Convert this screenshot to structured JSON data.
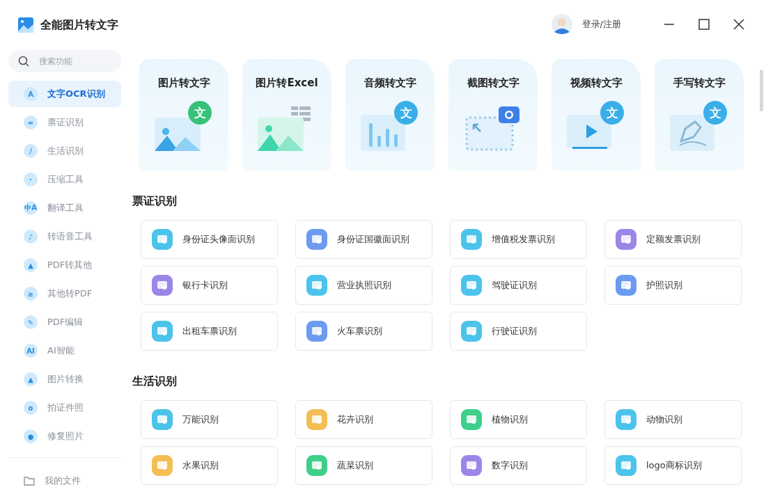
{
  "app": {
    "title": "全能图片转文字"
  },
  "header": {
    "login": "登录/注册"
  },
  "sidebar": {
    "search_placeholder": "搜索功能",
    "items": [
      {
        "label": "文字OCR识别",
        "glyph": "A",
        "selected": true
      },
      {
        "label": "票证识别",
        "glyph": "=",
        "selected": false
      },
      {
        "label": "生活识别",
        "glyph": "/",
        "selected": false
      },
      {
        "label": "压缩工具",
        "glyph": "·",
        "selected": false
      },
      {
        "label": "翻译工具",
        "glyph": "中A",
        "selected": false
      },
      {
        "label": "转语音工具",
        "glyph": "♪",
        "selected": false
      },
      {
        "label": "PDF转其他",
        "glyph": "▲",
        "selected": false
      },
      {
        "label": "其他转PDF",
        "glyph": "≥",
        "selected": false
      },
      {
        "label": "PDF编辑",
        "glyph": "✎",
        "selected": false
      },
      {
        "label": "AI智能",
        "glyph": "AI",
        "selected": false
      },
      {
        "label": "图片转换",
        "glyph": "▲",
        "selected": false
      },
      {
        "label": "拍证件照",
        "glyph": "o",
        "selected": false
      },
      {
        "label": "修复照片",
        "glyph": "●",
        "selected": false
      }
    ],
    "footer": {
      "label": "我的文件"
    }
  },
  "feature_cards": [
    {
      "title": "图片转文字",
      "kind": "image",
      "badge": "文"
    },
    {
      "title": "图片转Excel",
      "kind": "excel"
    },
    {
      "title": "音频转文字",
      "kind": "audio",
      "badge": "文"
    },
    {
      "title": "截图转文字",
      "kind": "screenshot"
    },
    {
      "title": "视频转文字",
      "kind": "video",
      "badge": "文"
    },
    {
      "title": "手写转文字",
      "kind": "handwriting",
      "badge": "文"
    }
  ],
  "sections": [
    {
      "title": "票证识别",
      "tools": [
        {
          "label": "身份证头像面识别",
          "color": "#4cc3ea"
        },
        {
          "label": "身份证国徽面识别",
          "color": "#6b9bf0"
        },
        {
          "label": "增值税发票识别",
          "color": "#4cc3ea"
        },
        {
          "label": "定额发票识别",
          "color": "#9b86e8"
        },
        {
          "label": "银行卡识别",
          "color": "#9b86e8"
        },
        {
          "label": "营业执照识别",
          "color": "#4cc3ea"
        },
        {
          "label": "驾驶证识别",
          "color": "#4cc3ea"
        },
        {
          "label": "护照识别",
          "color": "#6b9bf0"
        },
        {
          "label": "出租车票识别",
          "color": "#4cc3ea"
        },
        {
          "label": "火车票识别",
          "color": "#6b9bf0"
        },
        {
          "label": "行驶证识别",
          "color": "#4cc3ea"
        }
      ]
    },
    {
      "title": "生活识别",
      "tools": [
        {
          "label": "万能识别",
          "color": "#4cc3ea"
        },
        {
          "label": "花卉识别",
          "color": "#f3be55"
        },
        {
          "label": "植物识别",
          "color": "#3fcf8a"
        },
        {
          "label": "动物识别",
          "color": "#4cc3ea"
        },
        {
          "label": "水果识别",
          "color": "#f3be55"
        },
        {
          "label": "蔬菜识别",
          "color": "#3fcf8a"
        },
        {
          "label": "数字识别",
          "color": "#9b86e8"
        },
        {
          "label": "logo商标识别",
          "color": "#4cc3ea"
        }
      ]
    }
  ]
}
